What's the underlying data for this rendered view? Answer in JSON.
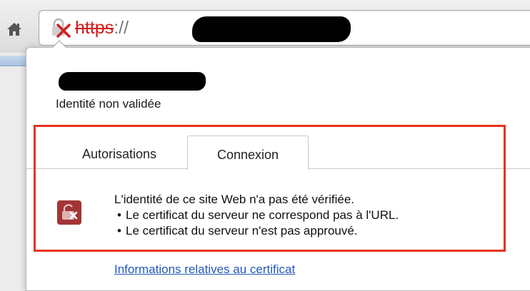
{
  "toolbar": {
    "home_icon": "home-icon",
    "security_icon": "broken-lock-x-icon",
    "url_scheme": "https",
    "url_separator": "://"
  },
  "popup": {
    "identity_status": "Identité non validée",
    "tabs": [
      {
        "label": "Autorisations",
        "selected": false
      },
      {
        "label": "Connexion",
        "selected": true
      }
    ],
    "connection": {
      "icon": "broken-lock-warning-icon",
      "title": "L'identité de ce site Web n'a pas été vérifiée.",
      "bullets": [
        "Le certificat du serveur ne correspond pas à l'URL.",
        "Le certificat du serveur n'est pas approuvé."
      ]
    },
    "certificate_link": "Informations relatives au certificat"
  },
  "colors": {
    "accent_red": "#e8321f",
    "link_blue": "#2458b8",
    "scheme_red": "#d01f1f",
    "warning_icon_bg": "#a33535"
  }
}
